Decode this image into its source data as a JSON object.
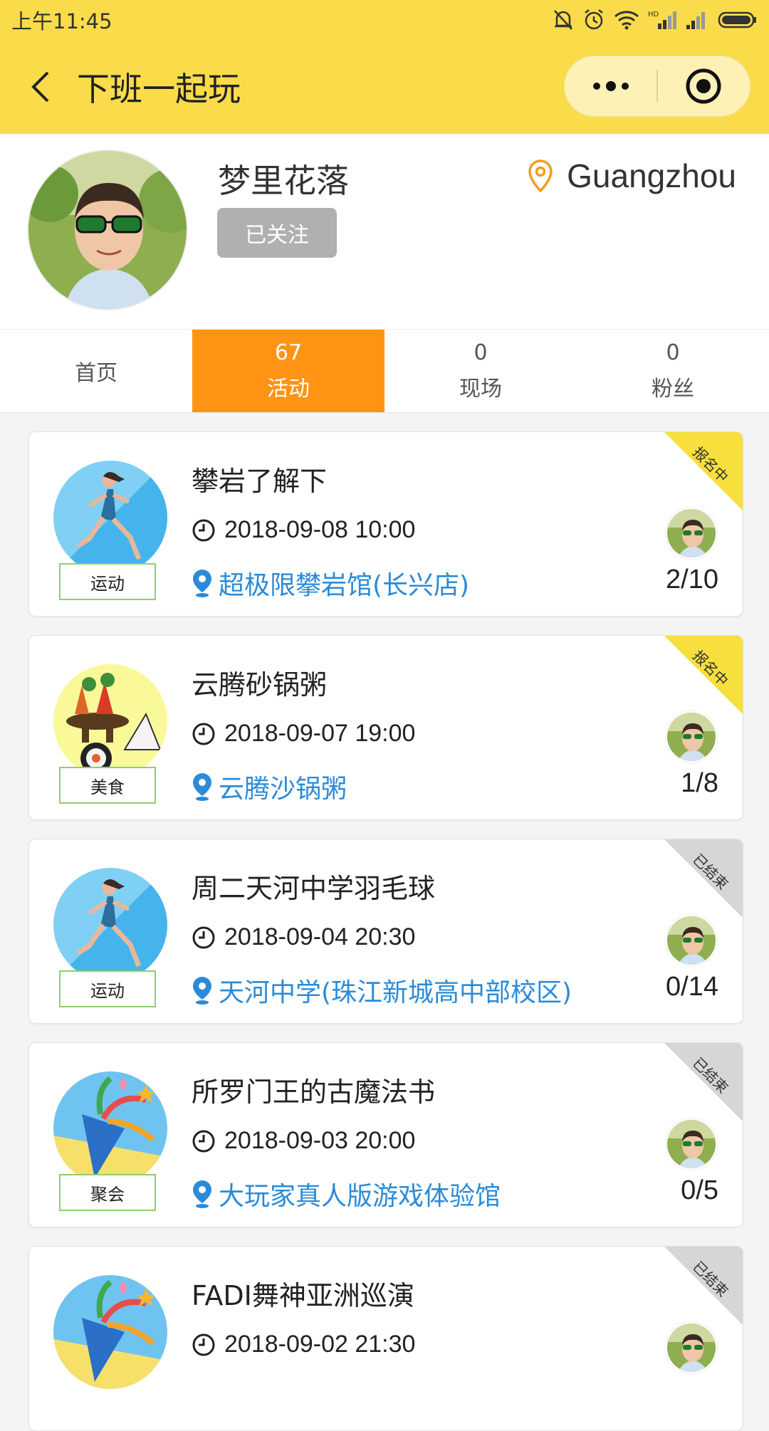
{
  "status_bar": {
    "time": "上午11:45"
  },
  "nav": {
    "title": "下班一起玩"
  },
  "profile": {
    "name": "梦里花落",
    "follow_label": "已关注",
    "location": "Guangzhou"
  },
  "tabs": [
    {
      "num": "",
      "label": "首页"
    },
    {
      "num": "67",
      "label": "活动"
    },
    {
      "num": "0",
      "label": "现场"
    },
    {
      "num": "0",
      "label": "粉丝"
    }
  ],
  "colors": {
    "header": "#fadc4a",
    "active_tab": "#ff9414",
    "link": "#2b8bd8",
    "ribbon_open": "#f7df3e",
    "ribbon_closed": "#d6d6d6"
  },
  "activities": [
    {
      "title": "攀岩了解下",
      "time": "2018-09-08 10:00",
      "location": "超极限攀岩馆(长兴店)",
      "category": "运动",
      "count": "2/10",
      "status": "报名中",
      "icon": "runner-icon"
    },
    {
      "title": "云腾砂锅粥",
      "time": "2018-09-07 19:00",
      "location": "云腾沙锅粥",
      "category": "美食",
      "count": "1/8",
      "status": "报名中",
      "icon": "food-icon"
    },
    {
      "title": "周二天河中学羽毛球",
      "time": "2018-09-04 20:30",
      "location": "天河中学(珠江新城高中部校区)",
      "category": "运动",
      "count": "0/14",
      "status": "已结束",
      "icon": "runner-icon"
    },
    {
      "title": "所罗门王的古魔法书",
      "time": "2018-09-03 20:00",
      "location": "大玩家真人版游戏体验馆",
      "category": "聚会",
      "count": "0/5",
      "status": "已结束",
      "icon": "party-icon"
    },
    {
      "title": "FADI舞神亚洲巡演",
      "time": "2018-09-02 21:30",
      "location": "",
      "category": "",
      "count": "",
      "status": "已结束",
      "icon": "party-icon"
    }
  ]
}
